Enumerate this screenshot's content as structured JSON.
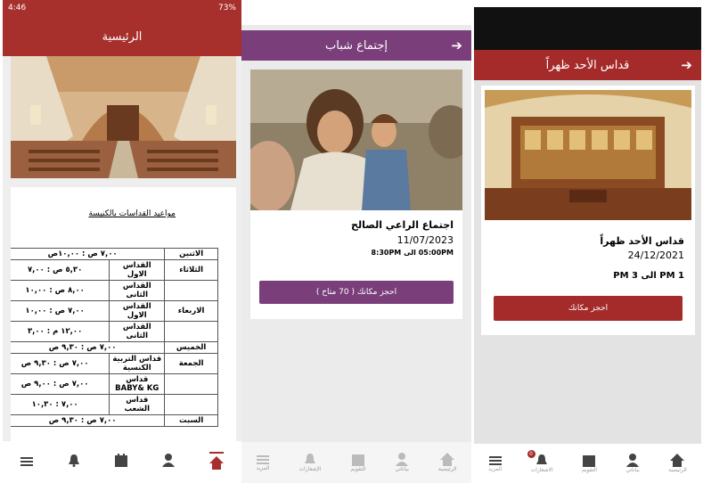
{
  "screen1": {
    "status": {
      "time": "4:46",
      "right": "73%"
    },
    "title": "الرئيسية",
    "schedule_title": "مواعيد القداسات بالكنيسة",
    "schedule": [
      {
        "day": "الاثنين",
        "mass": "",
        "time": "٧,٠٠ ص : ١٠,٠٠ص"
      },
      {
        "day": "الثلاثاء",
        "mass": "القداس الاول",
        "time": "٥,٣٠ ص : ٧,٠٠"
      },
      {
        "day": "",
        "mass": "القداس الثانى",
        "time": "٨,٠٠ ص : ١٠,٠٠"
      },
      {
        "day": "الاربعاء",
        "mass": "القداس الاول",
        "time": "٧,٠٠ ص : ١٠,٠٠"
      },
      {
        "day": "",
        "mass": "القداس الثانى",
        "time": "١٢,٠٠ م : ٣,٠٠"
      },
      {
        "day": "الخميس",
        "mass": "",
        "time": "٧,٠٠ ص : ٩,٣٠ ص"
      },
      {
        "day": "الجمعة",
        "mass": "قداس التربية الكنسية",
        "time": "٧,٠٠ ص : ٩,٣٠ ص"
      },
      {
        "day": "",
        "mass": "قداس BABY& KG",
        "time": "٧,٠٠ ص : ٩,٠٠ ص"
      },
      {
        "day": "",
        "mass": "قداس الشعب",
        "time": "٧,٠٠ : ١٠,٣٠"
      },
      {
        "day": "السبت",
        "mass": "",
        "time": "٧,٠٠ ص : ٩,٣٠ ص"
      }
    ]
  },
  "screen2": {
    "title": "إجتماع شباب",
    "event_title": "اجتماع الراعي الصالح",
    "date": "11/07/2023",
    "time_range": "05:00PM الى 8:30PM",
    "book_button": "احجز مكانك ( 70 متاح )",
    "nav": [
      "الرئيسية",
      "بياناتي",
      "التقويم",
      "الإشعارات",
      "المزيد"
    ]
  },
  "screen3": {
    "title": "قداس الأحد ظهراً",
    "event_title": "قداس الأحد ظهراً",
    "date": "24/12/2021",
    "time_range": "1 PM الى 3 PM",
    "book_button": "احجز مكانك",
    "notif_badge": "0",
    "nav": [
      "الرئيسية",
      "بياناتي",
      "التقويم",
      "الاشعارات",
      "المزيد"
    ]
  },
  "colors": {
    "maroon": "#a52a2a",
    "purple": "#7a3f7a"
  }
}
